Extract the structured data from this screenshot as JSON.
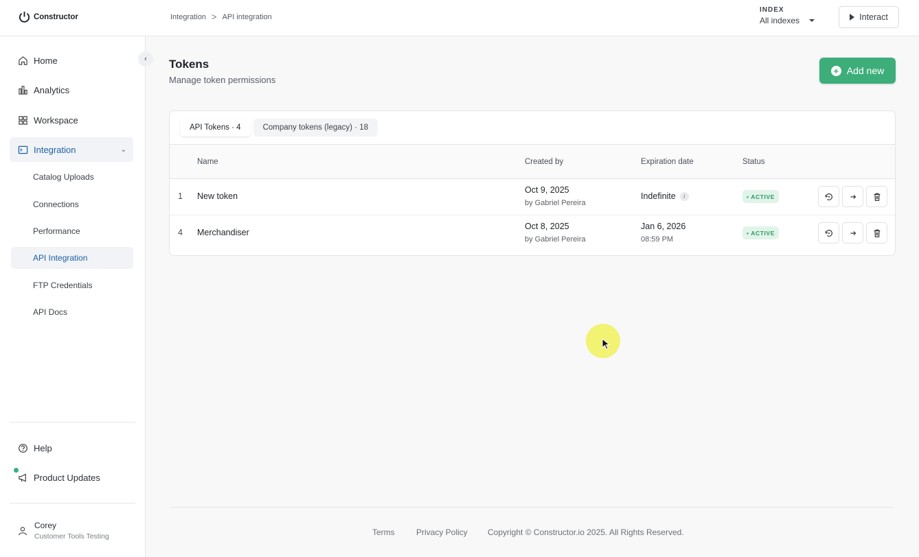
{
  "brand": {
    "name": "Constructor"
  },
  "breadcrumb": {
    "parent": "Integration",
    "separator": ">",
    "current": "API integration"
  },
  "index_selector": {
    "label": "INDEX",
    "value": "All indexes"
  },
  "interact_button": {
    "label": "Interact"
  },
  "sidebar": {
    "collapse_glyph": "‹",
    "items": [
      {
        "label": "Home",
        "icon": "home-icon"
      },
      {
        "label": "Analytics",
        "icon": "chart-icon"
      },
      {
        "label": "Workspace",
        "icon": "grid-icon"
      },
      {
        "label": "Integration",
        "icon": "terminal-icon",
        "active": true,
        "expanded": true
      }
    ],
    "sub_items": [
      {
        "label": "Catalog Uploads"
      },
      {
        "label": "Connections"
      },
      {
        "label": "Performance"
      },
      {
        "label": "API Integration",
        "active": true
      },
      {
        "label": "FTP Credentials"
      },
      {
        "label": "API Docs"
      }
    ],
    "bottom_items": [
      {
        "label": "Help",
        "icon": "help-icon"
      },
      {
        "label": "Product Updates",
        "icon": "megaphone-icon",
        "has_notification": true
      }
    ],
    "user": {
      "name": "Corey",
      "org": "Customer Tools Testing"
    }
  },
  "page": {
    "title": "Tokens",
    "subtitle": "Manage token permissions",
    "add_button": "Add new"
  },
  "tabs": [
    {
      "label": "API Tokens · 4",
      "active": true
    },
    {
      "label": "Company tokens (legacy) · 18",
      "active": false
    }
  ],
  "table": {
    "columns": [
      "Name",
      "Created by",
      "Expiration date",
      "Status"
    ],
    "rows": [
      {
        "index": "1",
        "name": "New token",
        "created_date": "Oct 9, 2025",
        "created_by": "by Gabriel Pereira",
        "expiration": "Indefinite",
        "expiration_time": "",
        "expiration_info": "i",
        "status": "• ACTIVE"
      },
      {
        "index": "4",
        "name": "Merchandiser",
        "created_date": "Oct 8, 2025",
        "created_by": "by Gabriel Pereira",
        "expiration": "Jan 6, 2026",
        "expiration_time": "08:59 PM",
        "status": "• ACTIVE"
      }
    ]
  },
  "footer": {
    "terms": "Terms",
    "privacy": "Privacy Policy",
    "copyright": "Copyright © Constructor.io 2025. All Rights Reserved."
  },
  "colors": {
    "accent_green": "#3dae7a",
    "active_blue": "#1d5fa8",
    "badge_bg": "#e1f4ea"
  }
}
